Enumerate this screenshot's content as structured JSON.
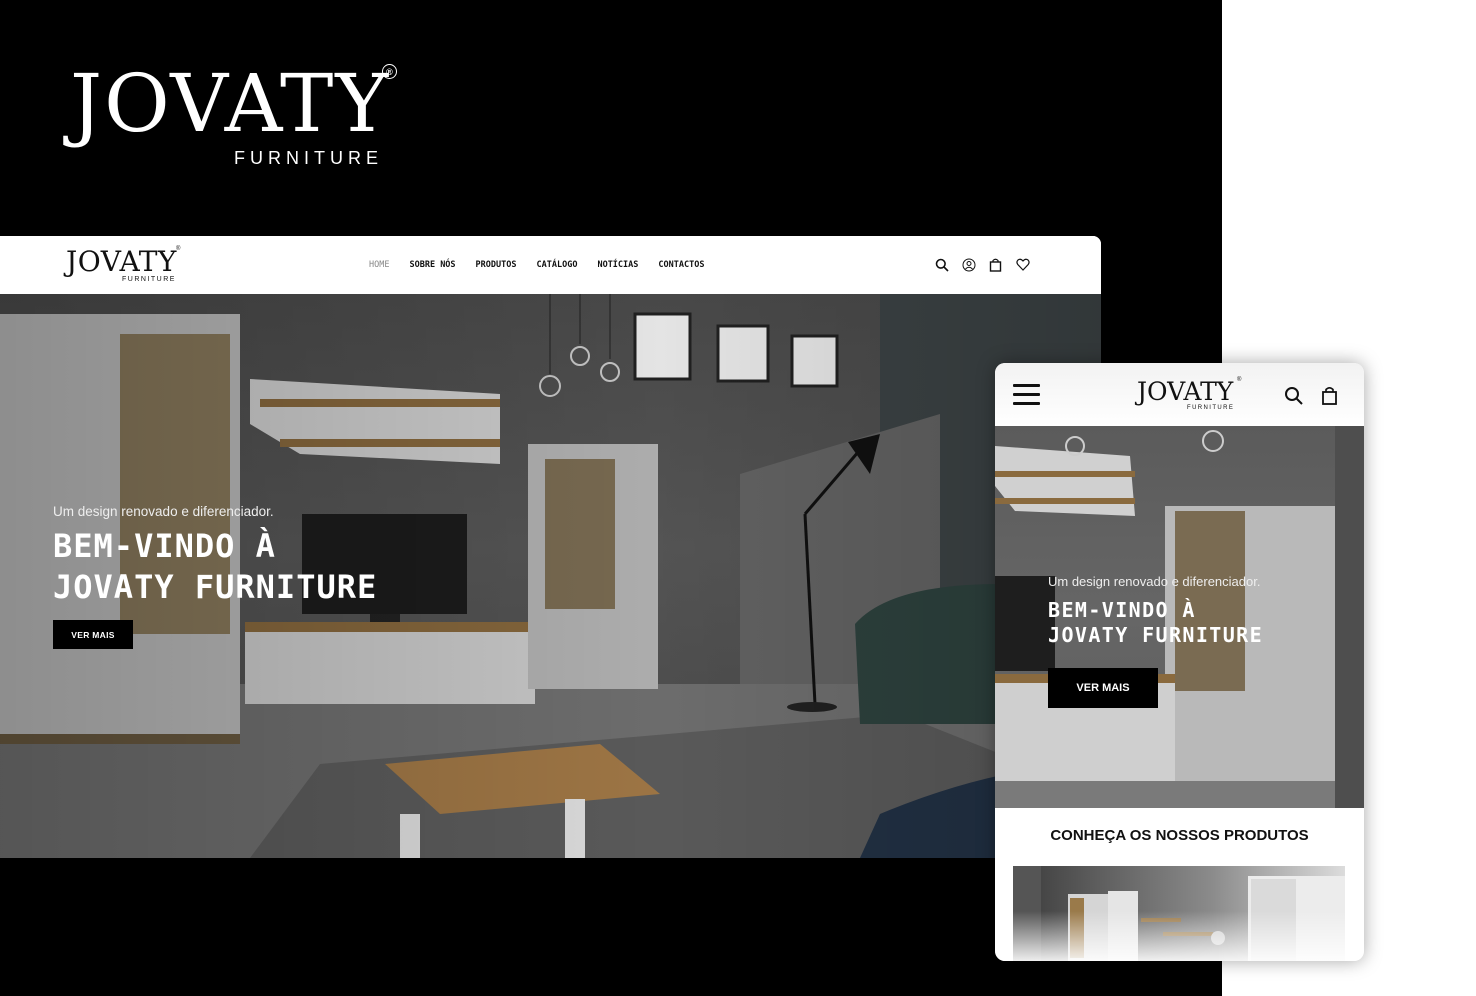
{
  "brand": {
    "name": "JOVATY",
    "subtitle": "FURNITURE",
    "registered": "®"
  },
  "desktop": {
    "nav": [
      {
        "label": "HOME",
        "active": true
      },
      {
        "label": "SOBRE NÓS"
      },
      {
        "label": "PRODUTOS"
      },
      {
        "label": "CATÁLOGO"
      },
      {
        "label": "NOTÍCIAS"
      },
      {
        "label": "CONTACTOS"
      }
    ],
    "icons": [
      "search-icon",
      "user-icon",
      "bag-icon",
      "heart-icon"
    ],
    "hero": {
      "subtitle": "Um design renovado e diferenciador.",
      "title_line1": "BEM-VINDO À",
      "title_line2": "JOVATY FURNITURE",
      "cta": "VER MAIS"
    }
  },
  "mobile": {
    "icons": [
      "menu-icon",
      "search-icon",
      "bag-icon"
    ],
    "hero": {
      "subtitle": "Um design renovado e diferenciador.",
      "title_line1": "BEM-VINDO À",
      "title_line2": "JOVATY FURNITURE",
      "cta": "VER MAIS"
    },
    "section_title": "CONHEÇA OS NOSSOS PRODUTOS"
  },
  "colors": {
    "background": "#000000",
    "accent": "#000000",
    "text_light": "#ffffff"
  }
}
